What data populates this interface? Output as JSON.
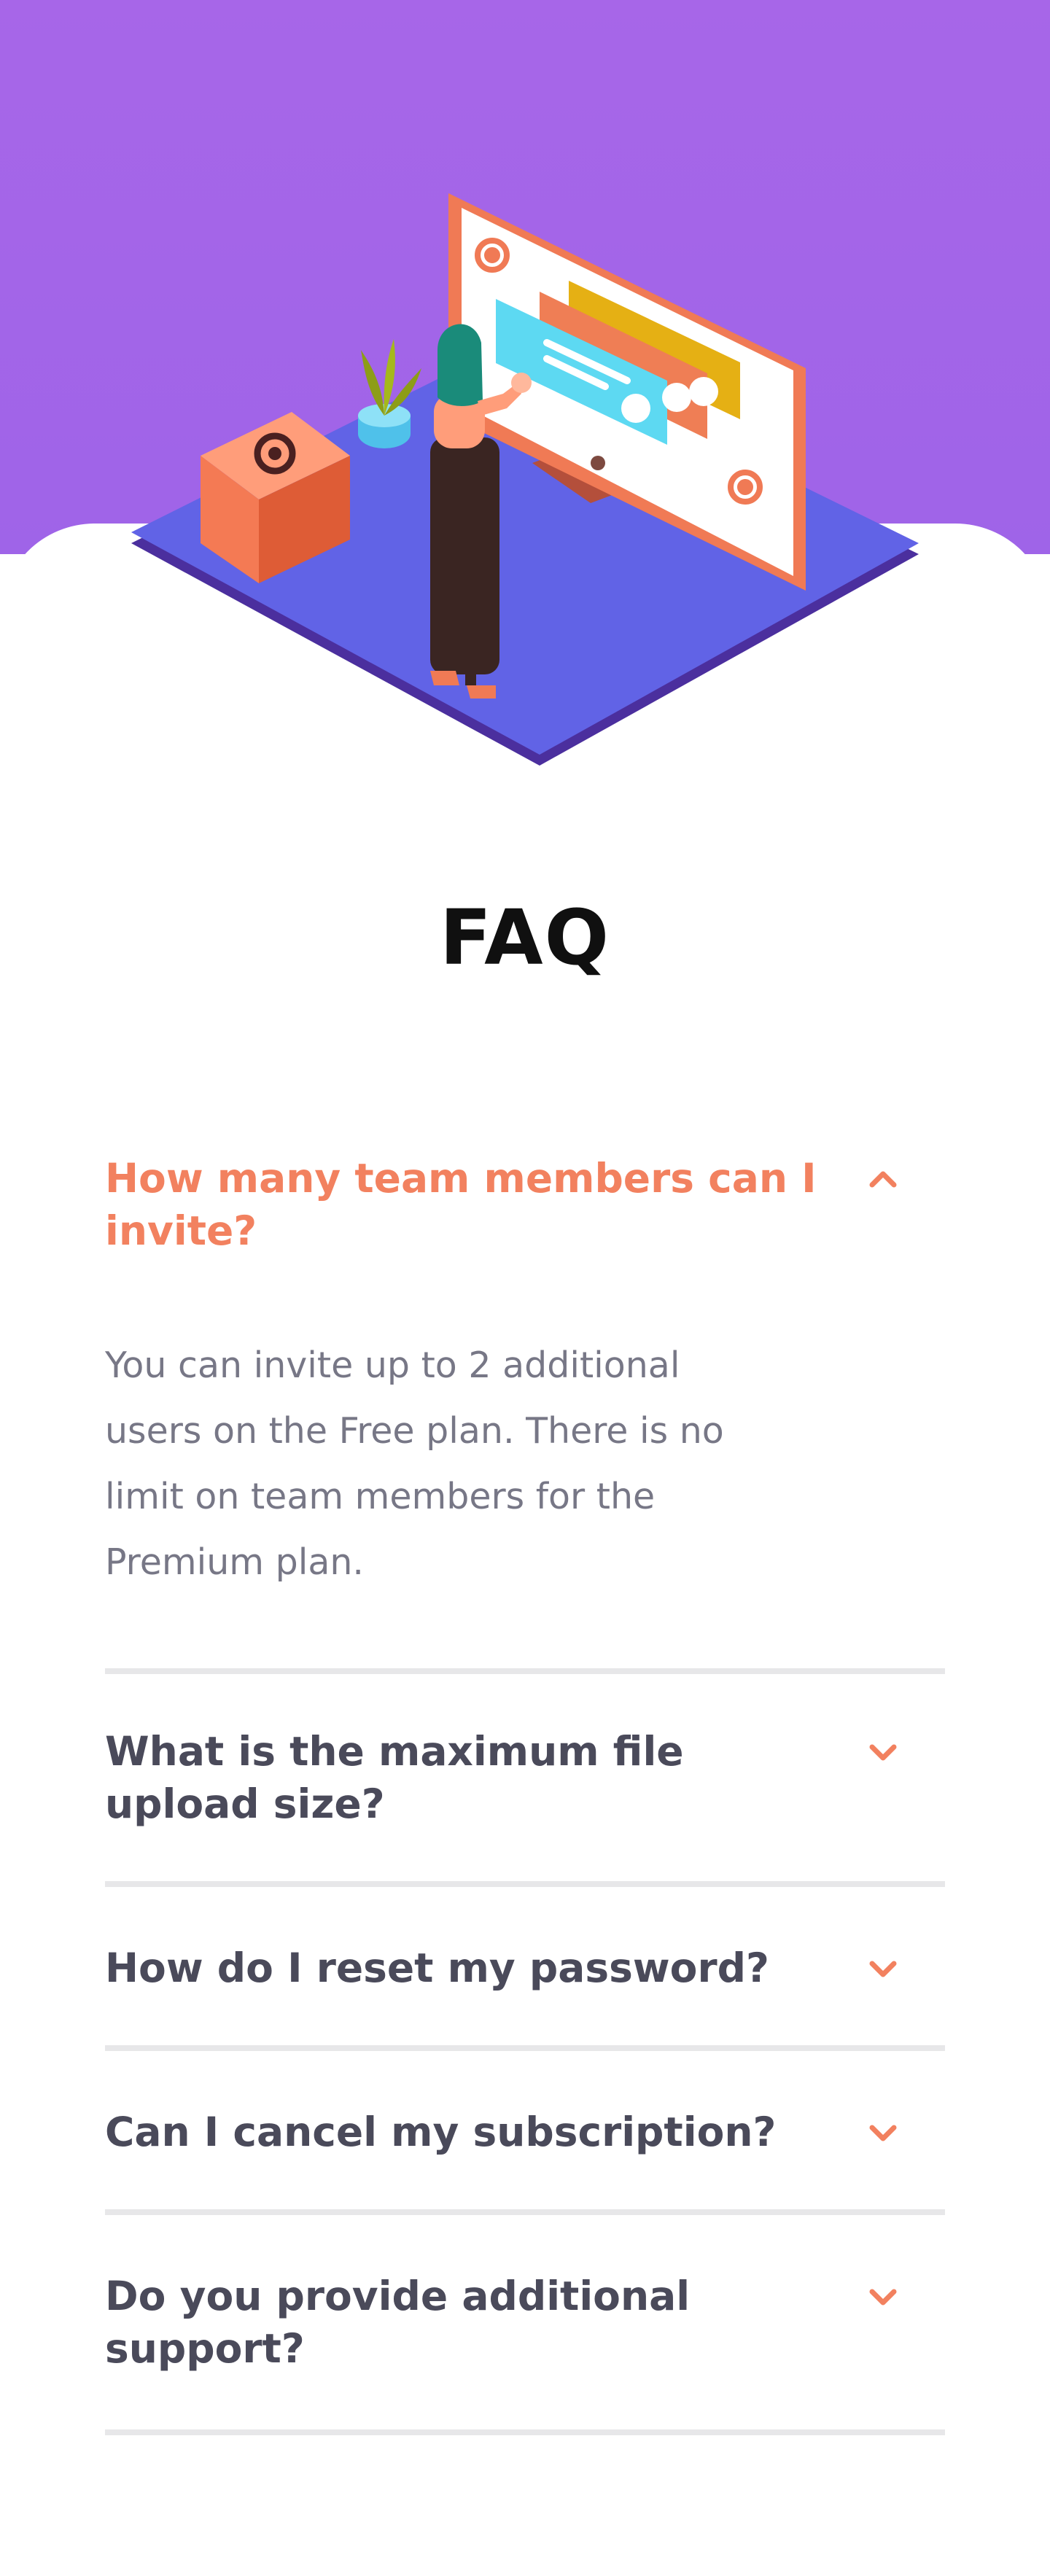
{
  "title": "FAQ",
  "colors": {
    "hero_background": "#a766e8",
    "accent": "#f2815f",
    "question_text": "#4a4a5a",
    "answer_text": "#777786",
    "divider": "#e7e7e9"
  },
  "illustration_icon": "email-at-icon",
  "faq": [
    {
      "question": "How many team members can I invite?",
      "answer": "You can invite up to 2 additional users on the Free plan. There is no limit on team members for the Premium plan.",
      "expanded": true,
      "icon": "chevron-up-icon"
    },
    {
      "question": "What is the maximum file upload size?",
      "expanded": false,
      "icon": "chevron-down-icon"
    },
    {
      "question": "How do I reset my password?",
      "expanded": false,
      "icon": "chevron-down-icon"
    },
    {
      "question": "Can I cancel my subscription?",
      "expanded": false,
      "icon": "chevron-down-icon"
    },
    {
      "question": "Do you provide additional support?",
      "expanded": false,
      "icon": "chevron-down-icon"
    }
  ]
}
